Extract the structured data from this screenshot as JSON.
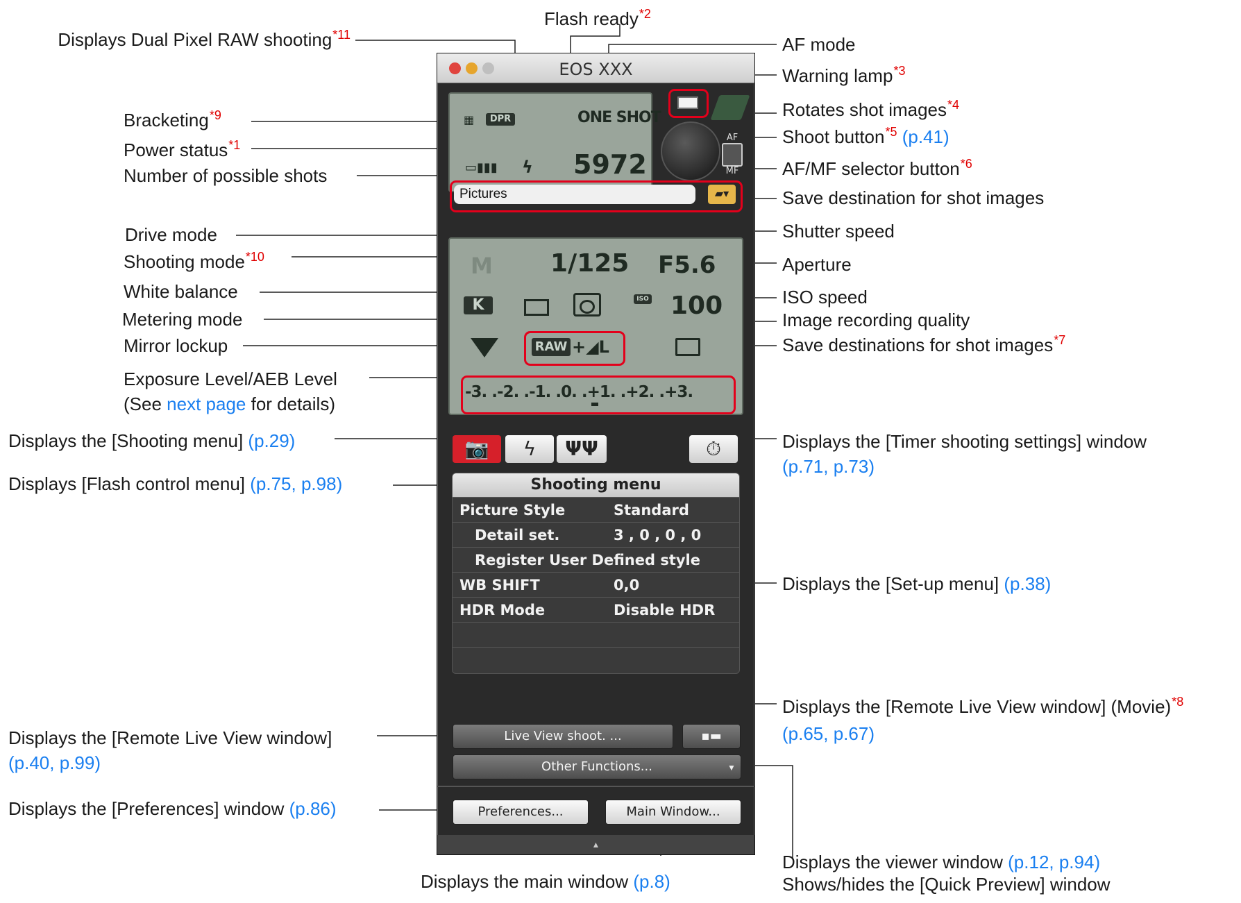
{
  "window": {
    "title": "EOS XXX",
    "lcd": {
      "bracketing_icon": "bracketing-icon",
      "dpr_badge": "DPR",
      "af_mode": "ONE SHOT",
      "flash_icon": "flash-icon",
      "shots_remaining": "5972"
    },
    "af_mf": {
      "top": "AF",
      "bottom": "MF"
    },
    "save_destination_value": "Pictures",
    "settings": {
      "shooting_mode": "M",
      "shutter_speed": "1/125",
      "aperture": "F5.6",
      "white_balance": "K",
      "iso_badge": "ISO",
      "iso_speed": "100",
      "quality_raw": "RAW",
      "quality_jpeg": "+◢L",
      "exposure_scale": "-3. .-2. .-1. .0. .+1. .+2. .+3."
    },
    "tabs": {
      "shooting": "📷",
      "flash": "ϟ",
      "setup": "ΨΨ",
      "timer": "⏱"
    },
    "menu": {
      "header": "Shooting menu",
      "rows": [
        {
          "label": "Picture Style",
          "value": "Standard"
        },
        {
          "label": "Detail set.",
          "value": "3 , 0 , 0 , 0"
        },
        {
          "label": "Register User Defined style",
          "value": ""
        },
        {
          "label": "WB SHIFT",
          "value": "0,0"
        },
        {
          "label": "HDR Mode",
          "value": "Disable HDR"
        }
      ]
    },
    "buttons": {
      "live_view": "Live View shoot. ...",
      "other_functions": "Other Functions...",
      "preferences": "Preferences...",
      "main_window": "Main Window..."
    }
  },
  "labels": {
    "dual_pixel": {
      "text": "Displays Dual Pixel RAW shooting",
      "note": "*11"
    },
    "flash_ready": {
      "text": "Flash ready",
      "note": "*2"
    },
    "af_mode": {
      "text": "AF mode"
    },
    "warning_lamp": {
      "text": "Warning lamp",
      "note": "*3"
    },
    "bracketing": {
      "text": "Bracketing",
      "note": "*9"
    },
    "rotates": {
      "text": "Rotates shot images",
      "note": "*4"
    },
    "power": {
      "text": "Power status",
      "note": "*1"
    },
    "shoot_button": {
      "text": "Shoot button",
      "note": "*5",
      "ref": "(p.41)"
    },
    "possible_shots": {
      "text": "Number of possible shots"
    },
    "afmf": {
      "text": "AF/MF selector button",
      "note": "*6"
    },
    "save_dest": {
      "text": "Save destination for shot images"
    },
    "drive": {
      "text": "Drive mode"
    },
    "shutter": {
      "text": "Shutter speed"
    },
    "shooting_mode": {
      "text": "Shooting mode",
      "note": "*10"
    },
    "aperture": {
      "text": "Aperture"
    },
    "wb": {
      "text": "White balance"
    },
    "iso": {
      "text": "ISO speed"
    },
    "metering": {
      "text": "Metering mode"
    },
    "quality": {
      "text": "Image recording quality"
    },
    "mirror": {
      "text": "Mirror lockup"
    },
    "save_dests": {
      "text": "Save destinations for shot images",
      "note": "*7"
    },
    "exposure": {
      "text": "Exposure Level/AEB Level",
      "line2_pre": "(See ",
      "line2_link": "next page",
      "line2_post": " for details)"
    },
    "shoot_menu": {
      "text": "Displays the [Shooting menu] ",
      "ref": "(p.29)"
    },
    "timer": {
      "text": "Displays the [Timer shooting settings] window",
      "ref": "(p.71, p.73)"
    },
    "flash_menu": {
      "text": "Displays [Flash control menu] ",
      "ref": "(p.75, p.98)"
    },
    "setup_menu": {
      "text": "Displays the [Set-up menu] ",
      "ref": "(p.38)"
    },
    "rlv_movie": {
      "text": "Displays the [Remote Live View window] (Movie)",
      "note": "*8",
      "ref": "(p.65, p.67)"
    },
    "rlv": {
      "text": "Displays the [Remote Live View window]",
      "ref": "(p.40, p.99)"
    },
    "prefs": {
      "text": "Displays the [Preferences] window ",
      "ref": "(p.86)"
    },
    "viewer": {
      "text": "Displays the viewer window ",
      "ref": "(p.12, p.94)",
      "line2": "Shows/hides the [Quick Preview] window"
    },
    "main_win": {
      "text": "Displays the main window ",
      "ref": "(p.8)"
    }
  },
  "colors": {
    "note_red": "#e00000",
    "link_blue": "#1a7ff0",
    "highlight_red": "#e3001b",
    "lcd_green": "#9aa59b"
  }
}
